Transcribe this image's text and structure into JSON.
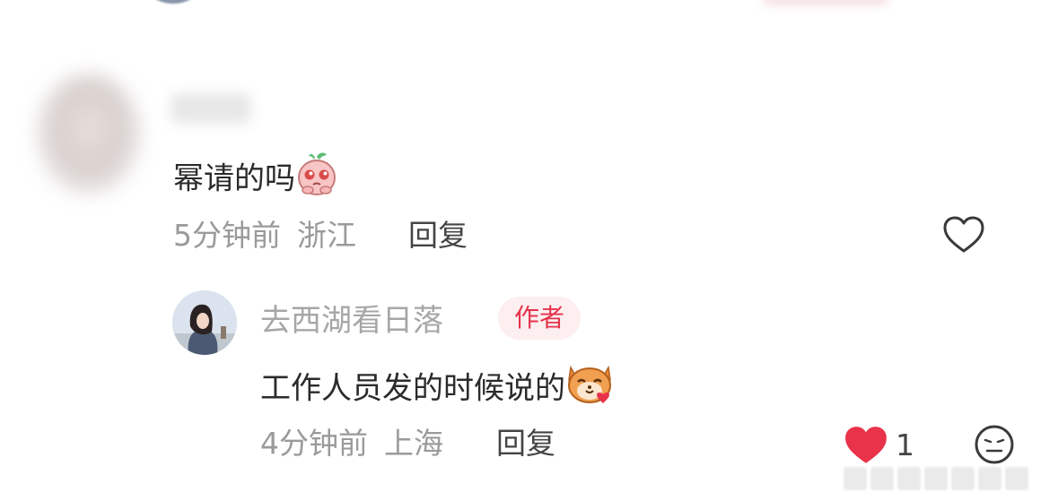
{
  "comment": {
    "text": "幂请的吗",
    "time": "5分钟前",
    "location": "浙江",
    "reply_label": "回复"
  },
  "reply": {
    "username": "去西湖看日落",
    "badge": "作者",
    "text": "工作人员发的时候说的",
    "time": "4分钟前",
    "location": "上海",
    "reply_label": "回复",
    "like_count": "1"
  },
  "icons": {
    "like_empty": "heart-outline-icon",
    "like_filled": "heart-filled-icon",
    "react": "neutral-face-icon",
    "emoji_1": "pink-blushing-face-emoji",
    "emoji_2": "cat-with-heart-emoji"
  },
  "colors": {
    "accent_red": "#e5334b",
    "meta_gray": "#9a9a9a"
  }
}
